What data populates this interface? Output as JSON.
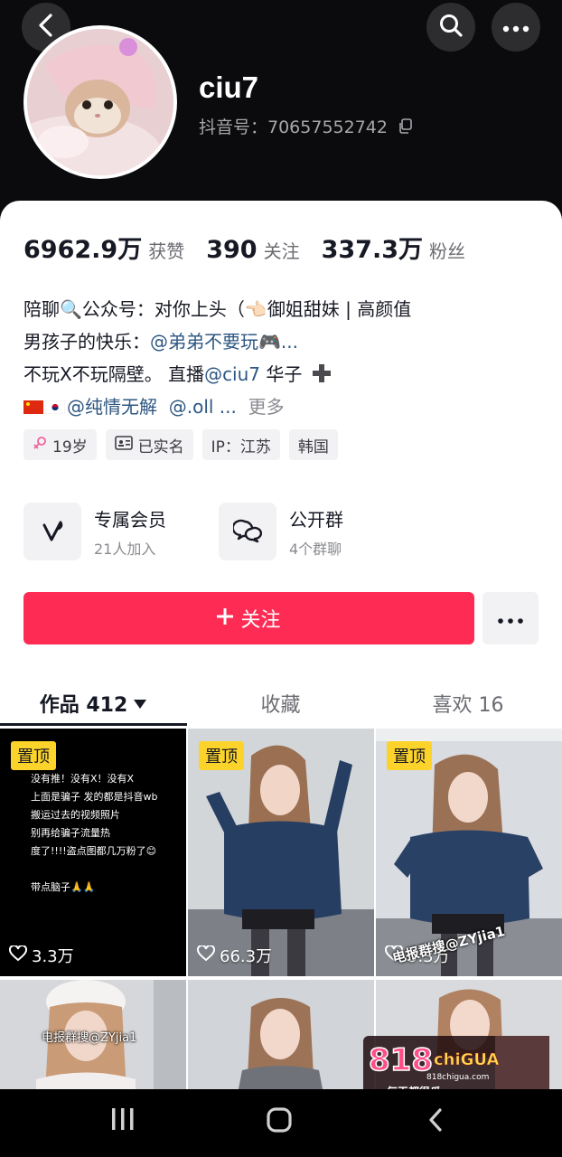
{
  "header": {
    "username": "ciu7",
    "douyin_id": "抖音号：70657552742",
    "icons": [
      "back-icon",
      "search-icon",
      "more-icon",
      "copy-icon"
    ]
  },
  "stats": [
    {
      "num": "6962.9万",
      "label": "获赞"
    },
    {
      "num": "390",
      "label": "关注"
    },
    {
      "num": "337.3万",
      "label": "粉丝"
    }
  ],
  "bio": {
    "l1a": "陪聊",
    "l1b": "公众号：对你上头（",
    "l1c": "御姐甜妹 | 高颜值",
    "l2a": "男孩子的快乐：",
    "l2b": "@弟弟不要玩",
    "l2c": "...",
    "l3a": "不玩X不玩隔壁。 直播",
    "l3b": "@ciu7",
    "l3c": " 华子",
    "l4a": "@纯情无解",
    "l4b": "@.oll ...",
    "l4c": "更多"
  },
  "tags": [
    "19岁",
    "已实名",
    "IP：江苏",
    "韩国"
  ],
  "features": {
    "member_title": "专属会员",
    "member_sub": "21人加入",
    "group_title": "公开群",
    "group_sub": "4个群聊"
  },
  "follow_label": "关注",
  "tabs": {
    "works": "作品 412",
    "favorites": "收藏",
    "likes": "喜欢 16"
  },
  "grid": {
    "pinned_label": "置顶",
    "text_post": [
      "没有推！没有X！没有X",
      "上面是骗子 发的都是抖音wb",
      "搬运过去的视频照片",
      "别再给骗子流量热",
      "度了!!!!盗点图都几万粉了😊",
      "",
      "带点脑子🙏🙏"
    ],
    "cells": [
      {
        "likes": "3.3万"
      },
      {
        "likes": "66.3万"
      },
      {
        "likes": "9.3万"
      }
    ]
  },
  "watermarks": [
    "电报群搜@ZYjia1",
    "电报群搜@ZYjia1"
  ],
  "ad": {
    "brand": "818chiGUA",
    "domain": "818chigua.com",
    "slogan": "每天都很瓜~"
  },
  "colors": {
    "accent": "#fe2c55",
    "pin": "#fcd32b",
    "link": "#2e5782"
  }
}
